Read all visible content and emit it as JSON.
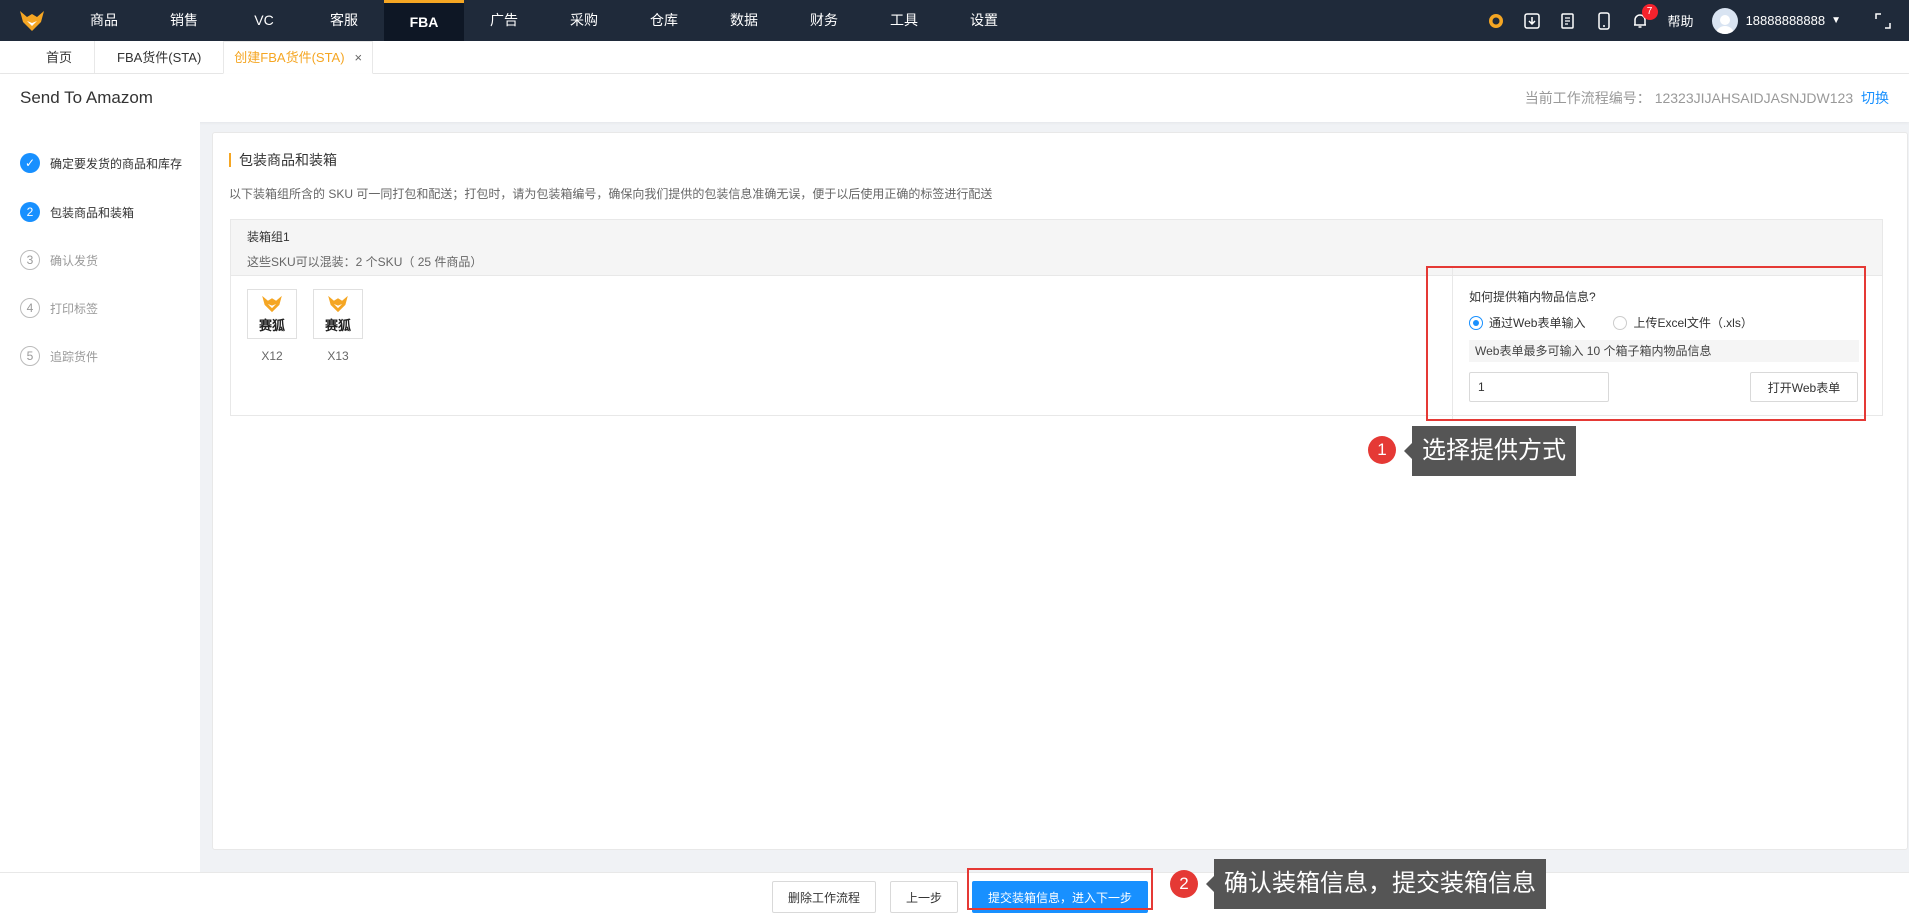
{
  "nav": {
    "items": [
      "商品",
      "销售",
      "VC",
      "客服",
      "FBA",
      "广告",
      "采购",
      "仓库",
      "数据",
      "财务",
      "工具",
      "设置"
    ],
    "active": "FBA",
    "notification_count": "7",
    "help": "帮助",
    "username": "18888888888"
  },
  "tabs": {
    "home": "首页",
    "fba": "FBA货件(STA)",
    "create": "创建FBA货件(STA)",
    "close": "×"
  },
  "header": {
    "title": "Send To Amazom",
    "workflow_label": "当前工作流程编号：",
    "workflow_code": "12323JIJAHSAIDJASNJDW123",
    "switch": "切换"
  },
  "steps": [
    {
      "num": "✓",
      "label": "确定要发货的商品和库存",
      "state": "done"
    },
    {
      "num": "2",
      "label": "包装商品和装箱",
      "state": "current"
    },
    {
      "num": "3",
      "label": "确认发货",
      "state": "pending"
    },
    {
      "num": "4",
      "label": "打印标签",
      "state": "pending"
    },
    {
      "num": "5",
      "label": "追踪货件",
      "state": "pending"
    }
  ],
  "main": {
    "section_title": "包装商品和装箱",
    "section_desc": "以下装箱组所含的 SKU 可一同打包和配送；打包时，请为包装箱编号，确保向我们提供的包装信息准确无误，便于以后使用正确的标签进行配送",
    "group": {
      "name": "装箱组1",
      "sub": "这些SKU可以混装：2 个SKU（ 25 件商品）",
      "products": [
        {
          "brand": "赛狐",
          "sku": "X12"
        },
        {
          "brand": "赛狐",
          "sku": "X13"
        }
      ]
    },
    "options": {
      "title": "如何提供箱内物品信息?",
      "radio_web": "通过Web表单输入",
      "radio_excel": "上传Excel文件（.xls）",
      "hint": "Web表单最多可输入 10 个箱子箱内物品信息",
      "count_value": "1",
      "open_button": "打开Web表单"
    }
  },
  "callouts": {
    "one_num": "1",
    "one_text": "选择提供方式",
    "two_num": "2",
    "two_text": "确认装箱信息，提交装箱信息"
  },
  "footer": {
    "delete": "删除工作流程",
    "prev": "上一步",
    "submit": "提交装箱信息，进入下一步"
  },
  "colors": {
    "accent": "#f5a623",
    "primary": "#1890ff",
    "highlight": "#e53935",
    "nav_bg": "#1f2a3a"
  }
}
